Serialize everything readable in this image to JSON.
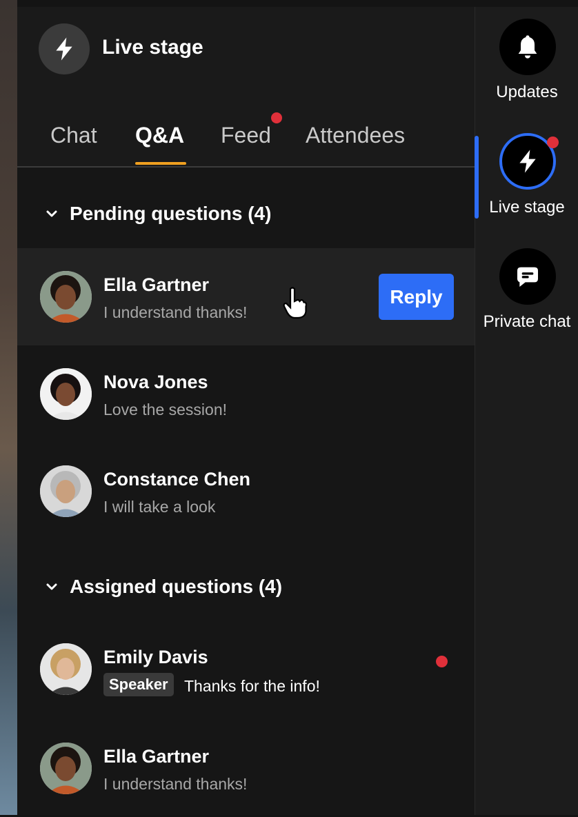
{
  "header": {
    "title": "Live stage"
  },
  "tabs": [
    {
      "label": "Chat"
    },
    {
      "label": "Q&A"
    },
    {
      "label": "Feed"
    },
    {
      "label": "Attendees"
    }
  ],
  "pending": {
    "heading": "Pending questions (4)",
    "items": [
      {
        "name": "Ella Gartner",
        "message": "I understand thanks!",
        "reply_label": "Reply"
      },
      {
        "name": "Nova Jones",
        "message": "Love the session!"
      },
      {
        "name": "Constance Chen",
        "message": "I will take a look"
      }
    ]
  },
  "assigned": {
    "heading": "Assigned questions (4)",
    "items": [
      {
        "name": "Emily Davis",
        "badge": "Speaker",
        "message": "Thanks for the info!"
      },
      {
        "name": "Ella Gartner",
        "message": "I understand thanks!"
      }
    ]
  },
  "rail": {
    "items": [
      {
        "label": "Updates",
        "icon": "bell-icon"
      },
      {
        "label": "Live stage",
        "icon": "lightning-icon"
      },
      {
        "label": "Private chat",
        "icon": "chat-bubble-icon"
      }
    ]
  },
  "colors": {
    "accent": "#2d6df6",
    "tab_underline": "#f0a020",
    "notify": "#e0303a"
  }
}
